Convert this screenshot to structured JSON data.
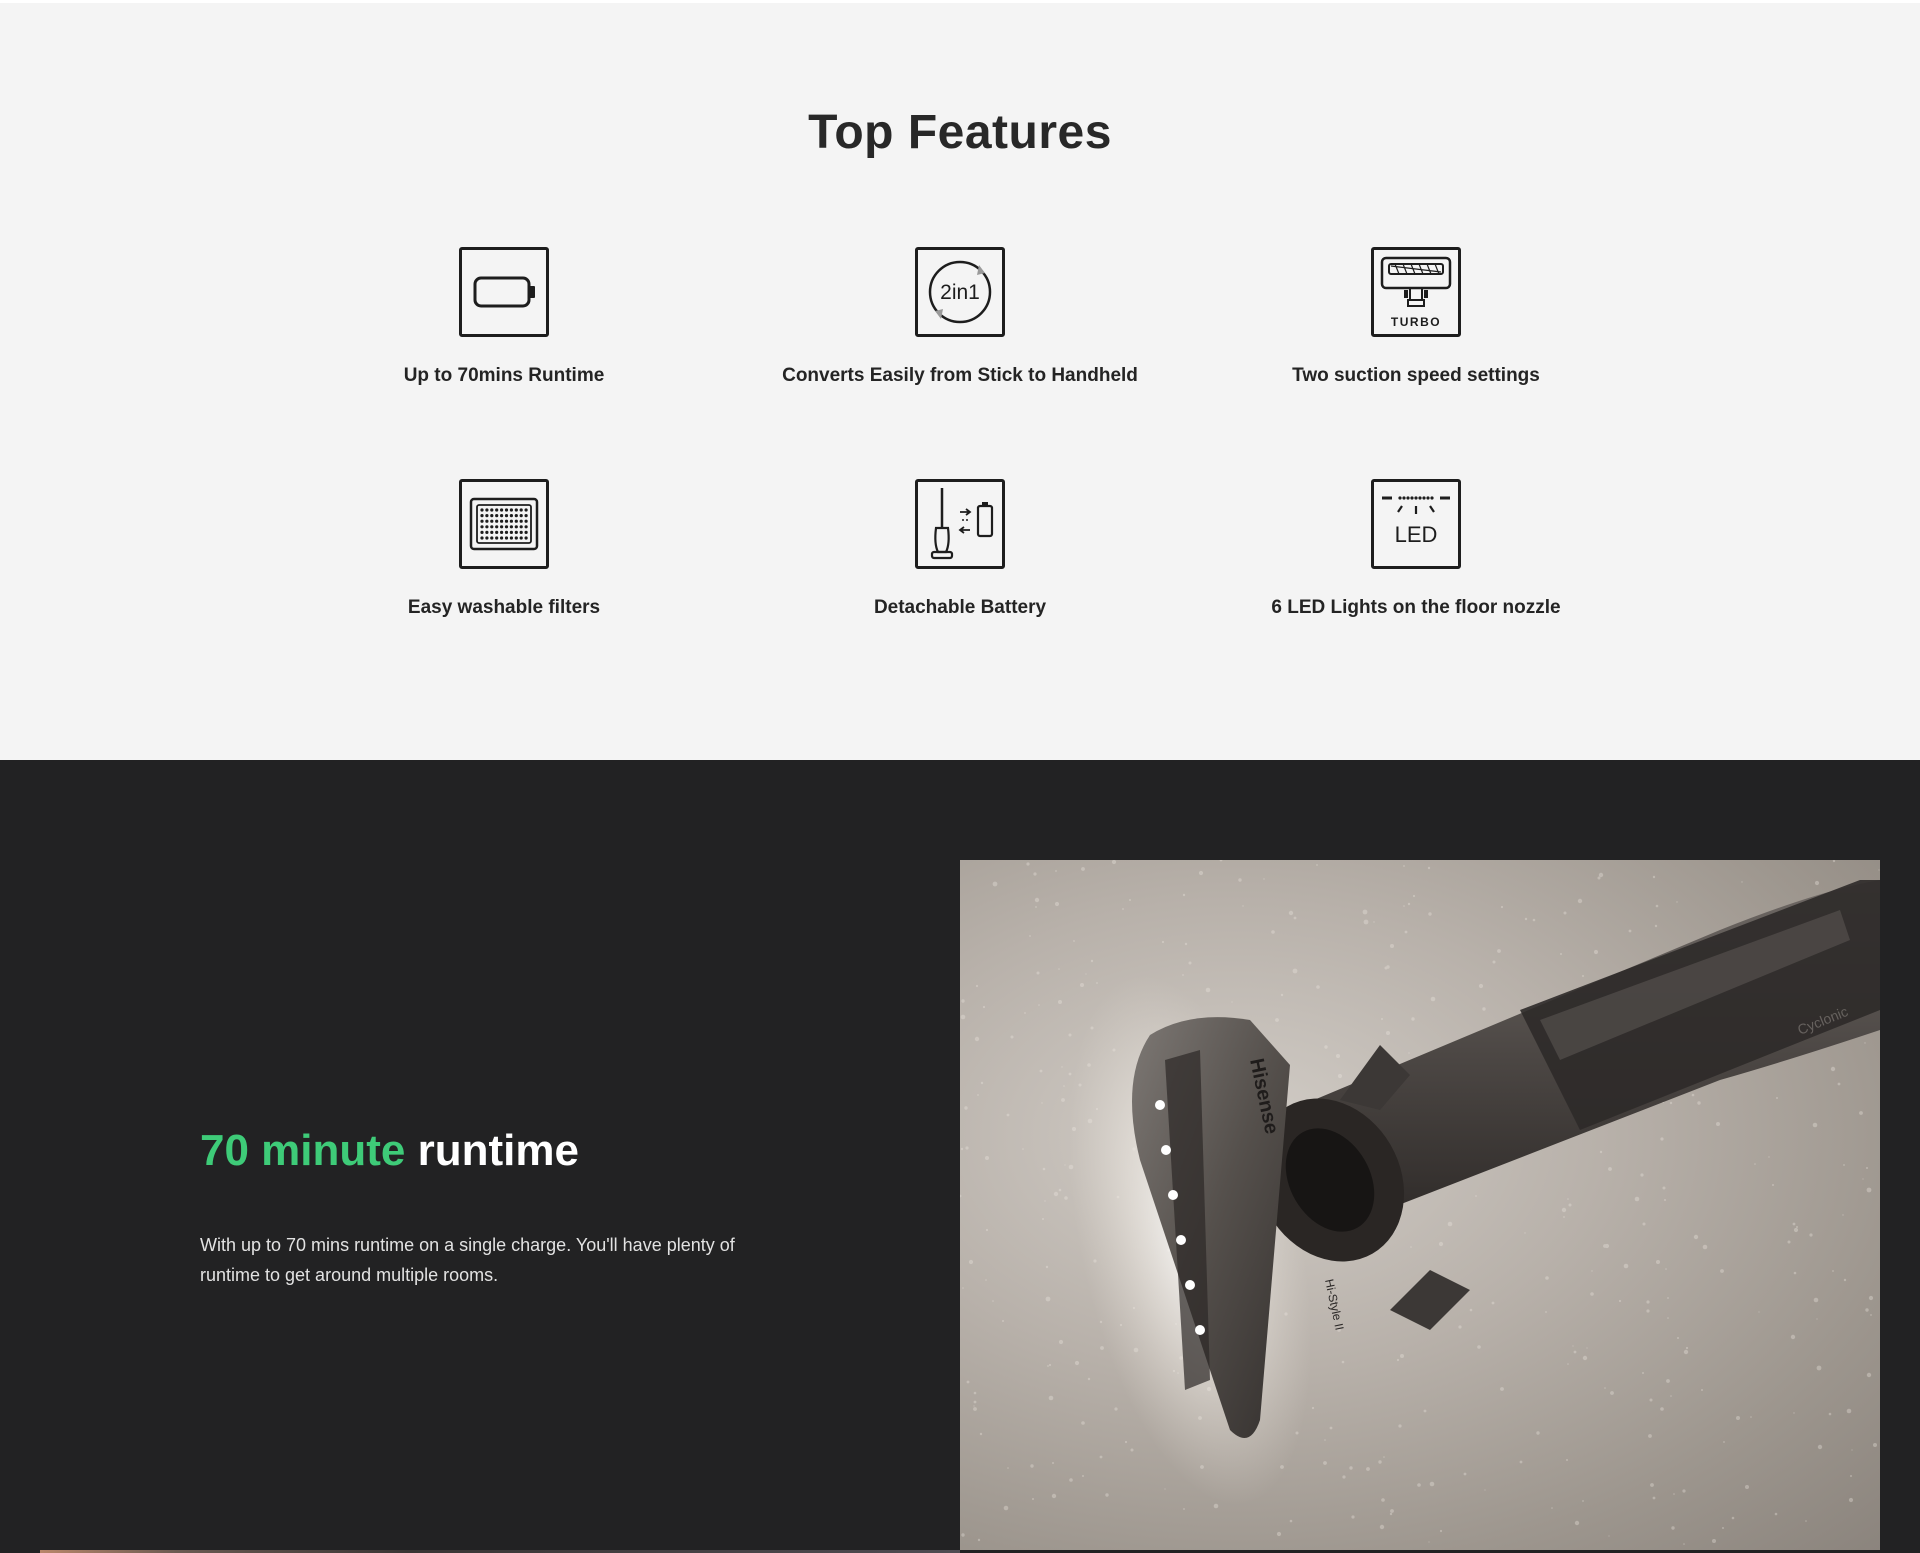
{
  "features_section": {
    "title": "Top Features",
    "items": [
      {
        "label": "Up to 70mins Runtime",
        "icon": "battery-icon"
      },
      {
        "label": "Converts Easily from Stick to Handheld",
        "icon": "2in1-icon",
        "icon_text": "2in1"
      },
      {
        "label": "Two suction speed settings",
        "icon": "turbo-nozzle-icon",
        "icon_text": "TURBO"
      },
      {
        "label": "Easy washable filters",
        "icon": "filter-icon"
      },
      {
        "label": "Detachable Battery",
        "icon": "detachable-battery-icon"
      },
      {
        "label": "6 LED Lights on the floor nozzle",
        "icon": "led-icon",
        "icon_text": "LED"
      }
    ]
  },
  "runtime_section": {
    "title_accent": "70 minute",
    "title_rest": " runtime",
    "description": "With up to 70 mins runtime on a single charge. You'll have plenty of runtime to get around multiple rooms.",
    "image": {
      "brand_text": "Hisense",
      "model_text": "Hi-Style II",
      "bin_text": "Cyclonic"
    }
  },
  "colors": {
    "accent_green": "#3ecb78",
    "dark_background": "#222223",
    "light_background": "#f4f4f4"
  }
}
